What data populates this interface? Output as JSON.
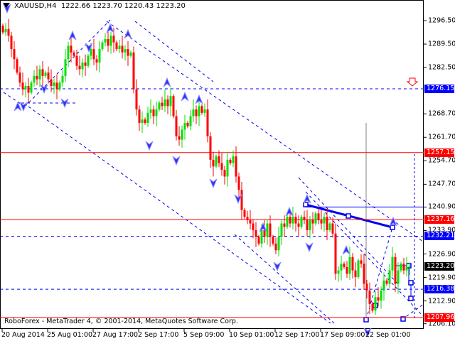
{
  "header": {
    "symbol": "XAUUSD,H4",
    "open": "1222.66",
    "high": "1223.70",
    "low": "1220.43",
    "close": "1223.20"
  },
  "footer": "RoboForex - MetaTrader 4, © 2001-2014, MetaQuotes Software Corp.",
  "colors": {
    "bull": "#00e000",
    "bear": "#ff0000",
    "blue": "#0000ee",
    "red_tag": "#ff0000",
    "blue_tag": "#0000ff",
    "black_tag": "#000000"
  },
  "chart_data": {
    "type": "candlestick",
    "ylim": [
      1204.5,
      1302
    ],
    "y_ticks": [
      "1296.50",
      "1289.50",
      "1282.50",
      "1268.70",
      "1261.70",
      "1254.70",
      "1247.70",
      "1240.90",
      "1233.90",
      "1226.90",
      "1219.90",
      "1212.90",
      "1206.10"
    ],
    "x_ticks": [
      "20 Aug 2014",
      "25 Aug 01:00",
      "27 Aug 17:00",
      "2 Sep 17:00",
      "5 Sep 09:00",
      "10 Sep 01:00",
      "12 Sep 17:00",
      "17 Sep 09:00",
      "22 Sep 01:00"
    ],
    "x_tick_index": [
      0,
      16,
      32,
      48,
      64,
      80,
      96,
      112,
      128
    ],
    "start_price": 1295,
    "closes": [
      1293,
      1294,
      1292,
      1288,
      1285,
      1281,
      1278,
      1276,
      1277,
      1275,
      1278,
      1280,
      1279,
      1282,
      1280,
      1281,
      1279,
      1277,
      1278,
      1276,
      1278,
      1280,
      1285,
      1289,
      1287,
      1286,
      1283,
      1282,
      1284,
      1283,
      1286,
      1288,
      1285,
      1284,
      1288,
      1290,
      1291,
      1289,
      1292,
      1290,
      1288,
      1289,
      1287,
      1288,
      1286,
      1287,
      1276,
      1270,
      1266,
      1267,
      1266,
      1269,
      1270,
      1268,
      1270,
      1272,
      1271,
      1273,
      1271,
      1274,
      1268,
      1262,
      1261,
      1264,
      1266,
      1265,
      1268,
      1270,
      1268,
      1271,
      1269,
      1270,
      1262,
      1255,
      1253,
      1256,
      1254,
      1252,
      1250,
      1255,
      1254,
      1256,
      1250,
      1246,
      1240,
      1238,
      1237,
      1236,
      1234,
      1232,
      1230,
      1234,
      1232,
      1236,
      1232,
      1230,
      1228,
      1232,
      1236,
      1235,
      1238,
      1236,
      1238,
      1236,
      1235,
      1238,
      1237,
      1234,
      1237,
      1236,
      1239,
      1237,
      1236,
      1238,
      1234,
      1236,
      1233,
      1221,
      1222,
      1224,
      1223,
      1221,
      1226,
      1222,
      1220,
      1225,
      1224,
      1218,
      1216,
      1212,
      1210,
      1214,
      1213,
      1216,
      1219,
      1218,
      1222,
      1226,
      1218,
      1222,
      1224,
      1222,
      1223,
      1223.2
    ],
    "levels": [
      {
        "price": 1276.15,
        "label": "1276.15",
        "style": "dashed",
        "color": "#0000ff"
      },
      {
        "price": 1257.15,
        "label": "1257.15",
        "style": "solid",
        "color": "#ff0000"
      },
      {
        "price": 1240.9,
        "label": "",
        "style": "solid",
        "color": "#0000ff"
      },
      {
        "price": 1237.16,
        "label": "1237.16",
        "style": "solid",
        "color": "#ff0000"
      },
      {
        "price": 1232.21,
        "label": "1232.21",
        "style": "dashed",
        "color": "#0000ff"
      },
      {
        "price": 1223.2,
        "label": "1223.20",
        "style": "none",
        "color": "#000000"
      },
      {
        "price": 1216.38,
        "label": "1216.38",
        "style": "dashed",
        "color": "#0000ff"
      },
      {
        "price": 1207.96,
        "label": "1207.96",
        "style": "solid",
        "color": "#ff0000"
      }
    ]
  }
}
